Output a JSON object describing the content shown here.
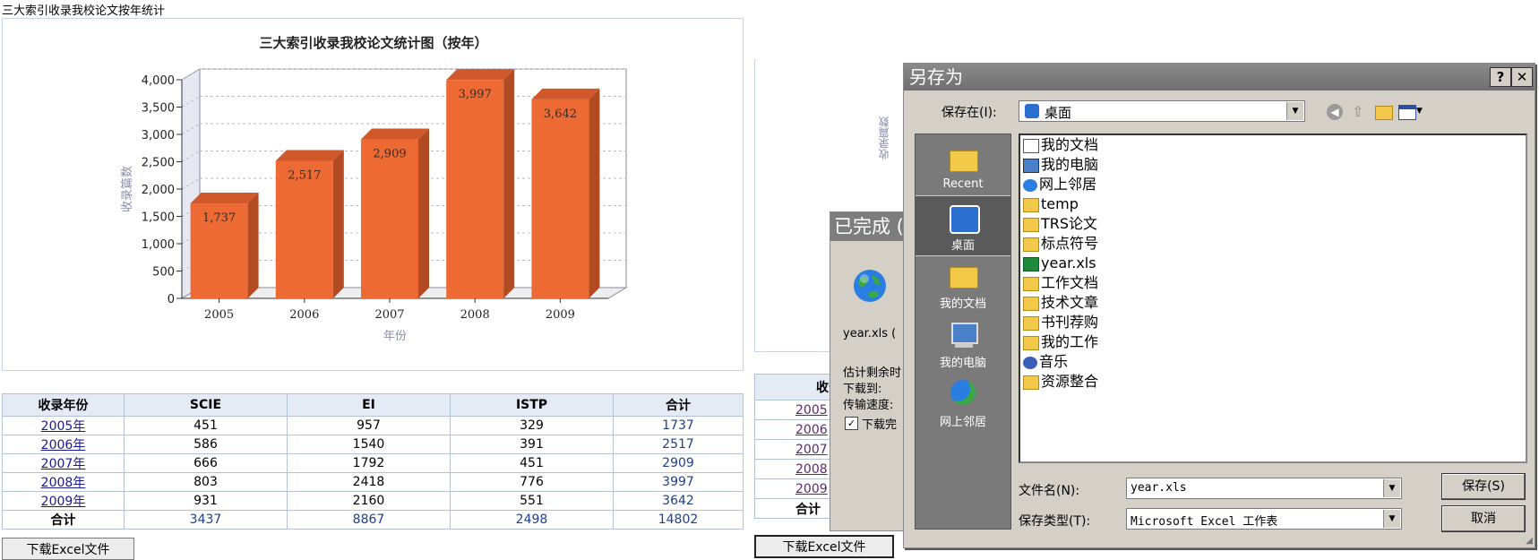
{
  "page": {
    "heading": "三大索引收录我校论文按年统计"
  },
  "chart_data": {
    "type": "bar",
    "title": "三大索引收录我校论文统计图（按年）",
    "xlabel": "年份",
    "ylabel": "收录篇数",
    "categories": [
      "2005",
      "2006",
      "2007",
      "2008",
      "2009"
    ],
    "values": [
      1737,
      2517,
      2909,
      3997,
      3642
    ],
    "value_labels": [
      "1,737",
      "2,517",
      "2,909",
      "3,997",
      "3,642"
    ],
    "yticks": [
      "0",
      "500",
      "1,000",
      "1,500",
      "2,000",
      "2,500",
      "3,000",
      "3,500",
      "4,000"
    ],
    "ylim": [
      0,
      4000
    ],
    "color": "#ee6a35",
    "grid": true,
    "style": "3d"
  },
  "table": {
    "headers": [
      "收录年份",
      "SCIE",
      "EI",
      "ISTP",
      "合计"
    ],
    "rows": [
      {
        "year": "2005年",
        "scie": "451",
        "ei": "957",
        "istp": "329",
        "total": "1737"
      },
      {
        "year": "2006年",
        "scie": "586",
        "ei": "1540",
        "istp": "391",
        "total": "2517"
      },
      {
        "year": "2007年",
        "scie": "666",
        "ei": "1792",
        "istp": "451",
        "total": "2909"
      },
      {
        "year": "2008年",
        "scie": "803",
        "ei": "2418",
        "istp": "776",
        "total": "3997"
      },
      {
        "year": "2009年",
        "scie": "931",
        "ei": "2160",
        "istp": "551",
        "total": "3642"
      }
    ],
    "footer": {
      "label": "合计",
      "scie": "3437",
      "ei": "8867",
      "istp": "2498",
      "total": "14802"
    }
  },
  "download_button": "下载Excel文件",
  "background_page": {
    "ylabel": "收录篇数",
    "header": "收录年",
    "rows": [
      "2005",
      "2006",
      "2007",
      "2008",
      "2009"
    ],
    "footer": "合计"
  },
  "progress_dialog": {
    "title": "已完成 (",
    "filename": "year.xls (",
    "line1": "估计剩余时",
    "line2": "下载到:",
    "line3": "传输速度:",
    "checkbox_label": "下载完",
    "check": "✓"
  },
  "save_dialog": {
    "title": "另存为",
    "help": "?",
    "close": "✕",
    "save_in_label": "保存在(I):",
    "save_in_value": "桌面",
    "places": [
      "Recent",
      "桌面",
      "我的文档",
      "我的电脑",
      "网上邻居"
    ],
    "files": [
      "我的文档",
      "我的电脑",
      "网上邻居",
      "temp",
      "TRS论文",
      "标点符号",
      "year.xls",
      "工作文档",
      "技术文章",
      "书刊荐购",
      "我的工作",
      "音乐",
      "资源整合"
    ],
    "filename_label": "文件名(N):",
    "filename_value": "year.xls",
    "filetype_label": "保存类型(T):",
    "filetype_value": "Microsoft Excel 工作表",
    "save_button": "保存(S)",
    "cancel_button": "取消"
  }
}
